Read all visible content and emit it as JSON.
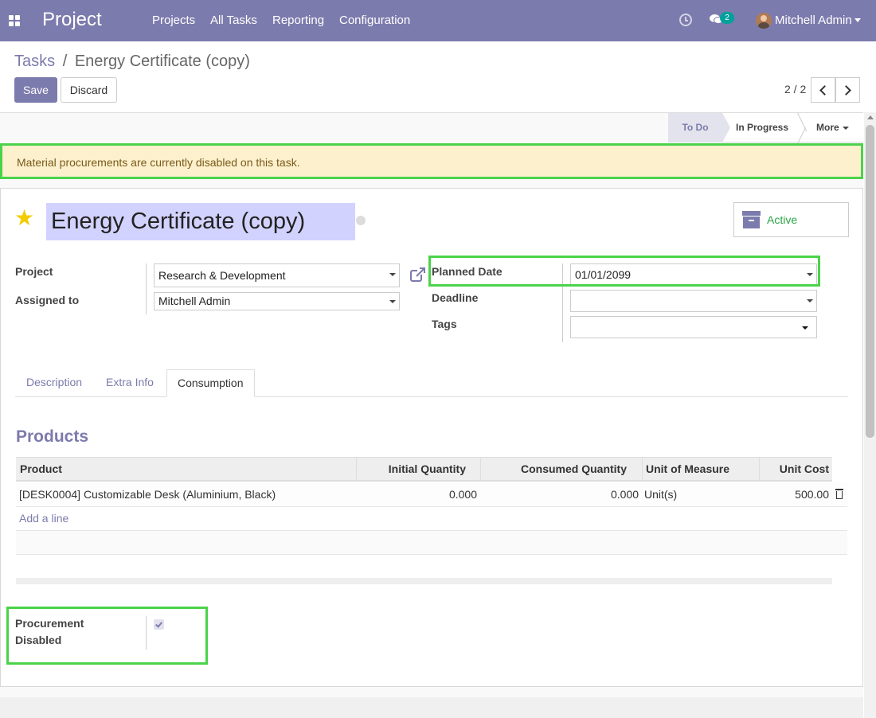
{
  "navbar": {
    "app_name": "Project",
    "menu": [
      "Projects",
      "All Tasks",
      "Reporting",
      "Configuration"
    ],
    "chat_count": "2",
    "user": "Mitchell Admin",
    "color": "#7c7bad"
  },
  "control_panel": {
    "breadcrumb_parent": "Tasks",
    "breadcrumb_sep": "/",
    "breadcrumb_current": "Energy Certificate (copy)",
    "save_label": "Save",
    "discard_label": "Discard",
    "pager": "2 / 2"
  },
  "statusbar": {
    "stages": [
      "To Do",
      "In Progress"
    ],
    "active_stage": "To Do",
    "more_label": "More"
  },
  "alert": {
    "text": "Material procurements are currently disabled on this task.",
    "color": "#fcf0cd"
  },
  "task": {
    "title": "Energy Certificate (copy)",
    "active_label": "Active",
    "fields": {
      "project_label": "Project",
      "project_value": "Research & Development",
      "assigned_label": "Assigned to",
      "assigned_value": "Mitchell Admin",
      "planned_label": "Planned Date",
      "planned_value": "01/01/2099",
      "deadline_label": "Deadline",
      "deadline_value": "",
      "tags_label": "Tags",
      "tags_value": ""
    }
  },
  "tabs": [
    "Description",
    "Extra Info",
    "Consumption"
  ],
  "active_tab": "Consumption",
  "products": {
    "title": "Products",
    "columns": [
      "Product",
      "Initial Quantity",
      "Consumed Quantity",
      "Unit of Measure",
      "Unit Cost"
    ],
    "rows": [
      {
        "product": "[DESK0004] Customizable Desk (Aluminium, Black)",
        "initial_qty": "0.000",
        "consumed_qty": "0.000",
        "uom": "Unit(s)",
        "unit_cost": "500.00"
      }
    ],
    "add_line": "Add a line"
  },
  "procurement": {
    "label_line1": "Procurement",
    "label_line2": "Disabled",
    "checked": true
  },
  "colors": {
    "highlight": "#4ad34a",
    "accent": "#7c7bad",
    "active_green": "#28a745"
  },
  "icons": [
    "apps-icon",
    "clock-icon",
    "chat-icon",
    "avatar",
    "caret-down-icon",
    "chevron-left-icon",
    "chevron-right-icon",
    "star-icon",
    "archive-icon",
    "external-link-icon",
    "trash-icon",
    "check-icon"
  ]
}
